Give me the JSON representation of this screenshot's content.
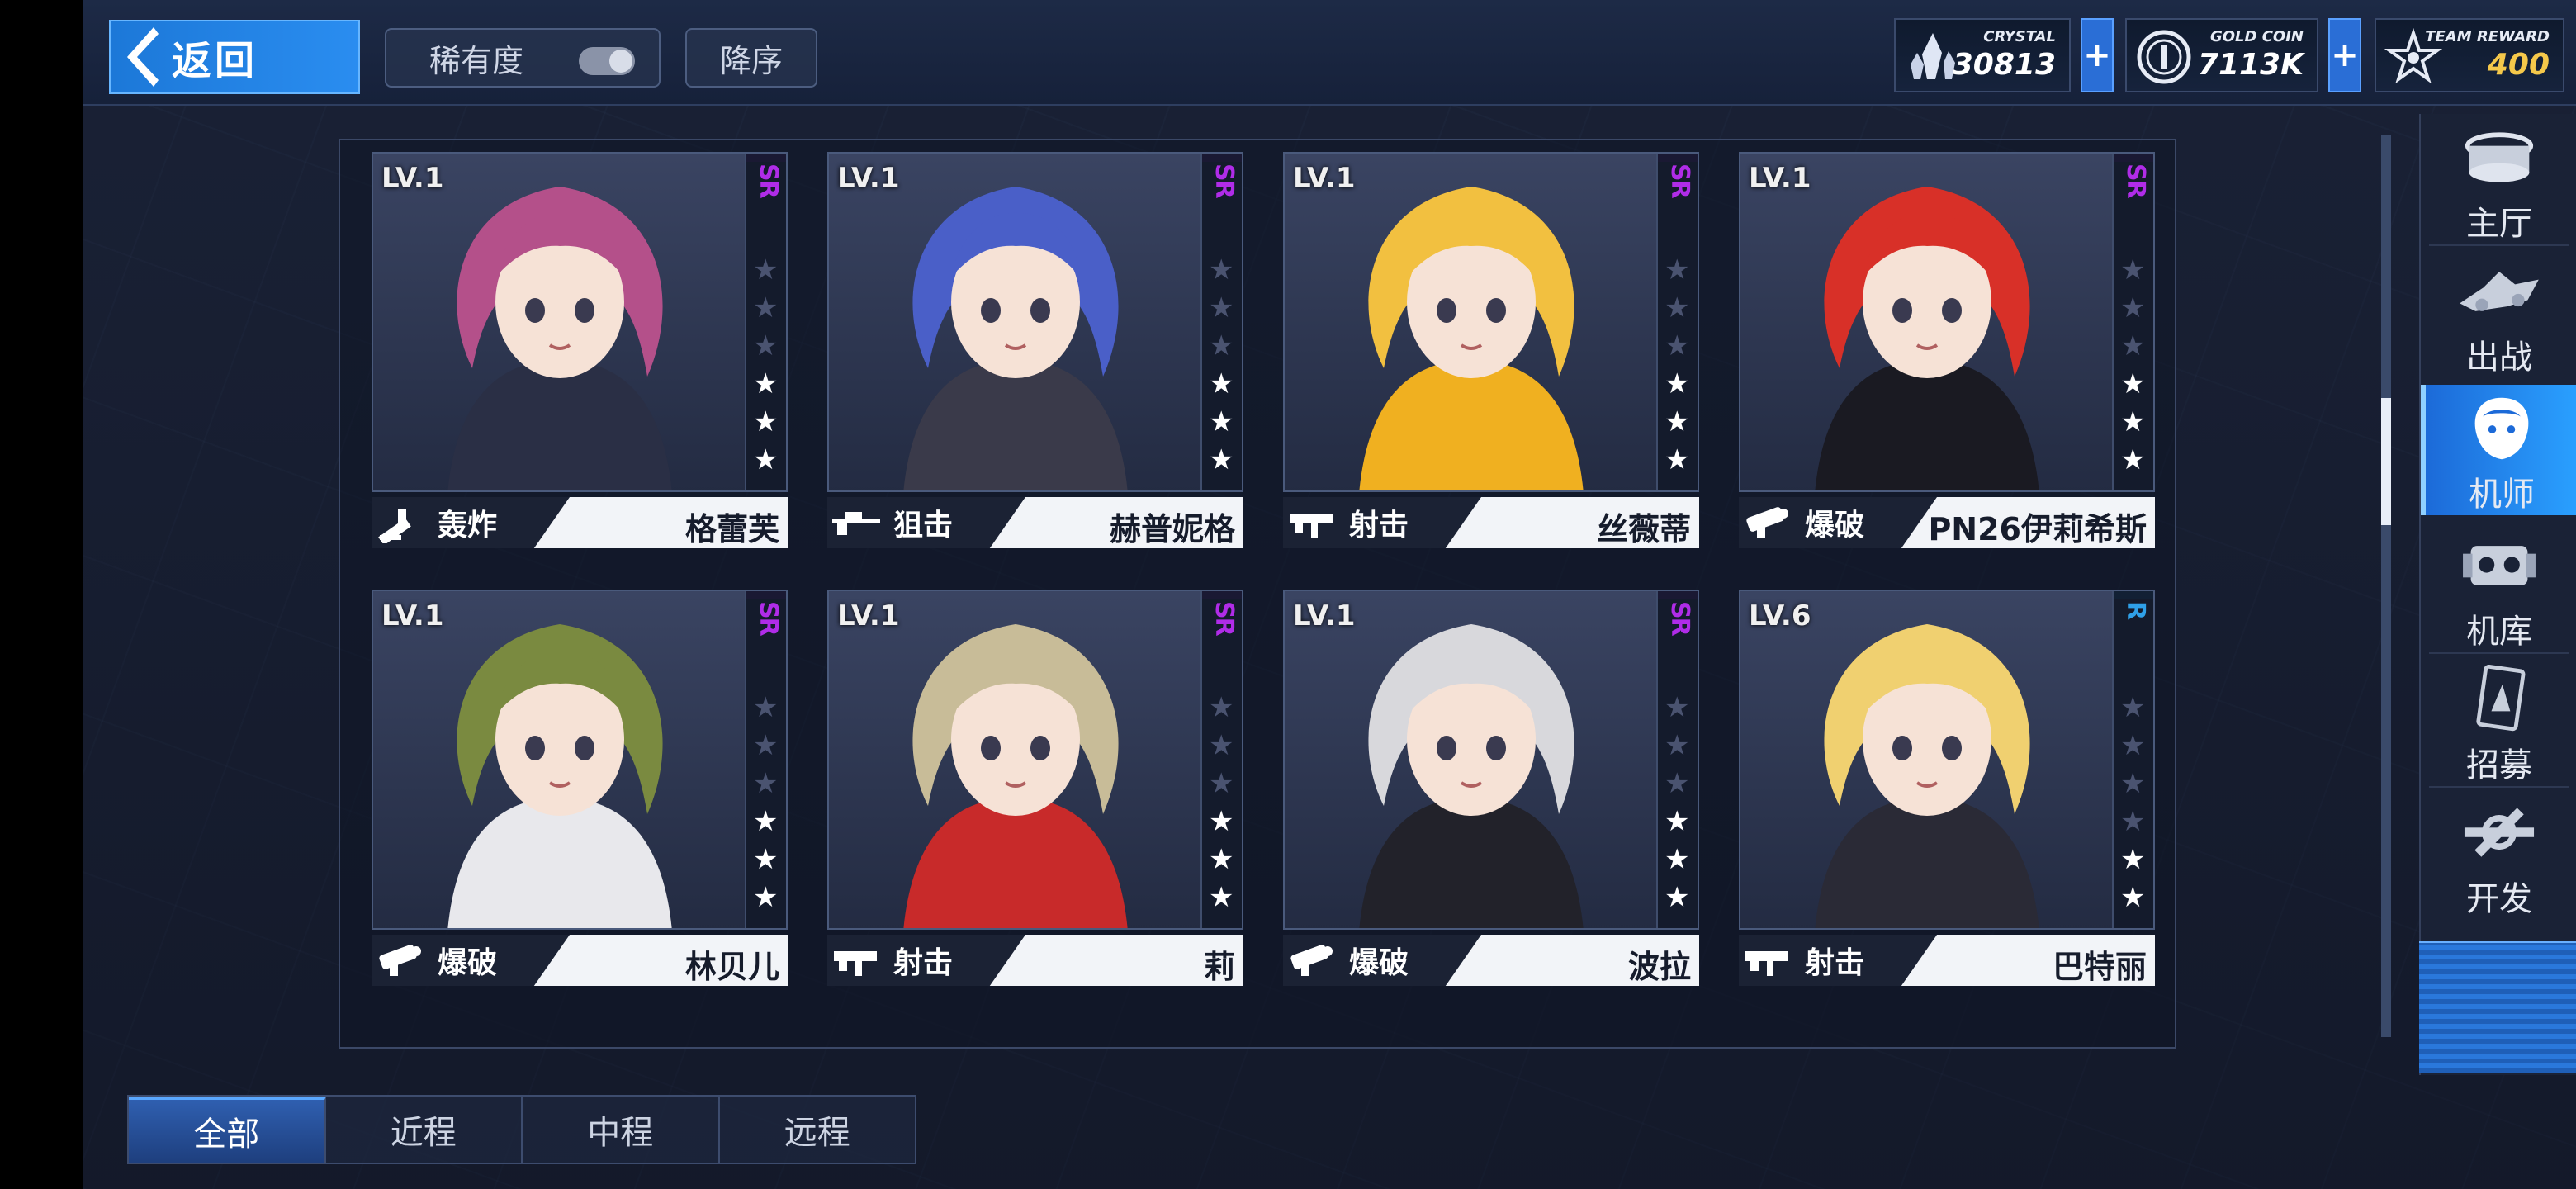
{
  "header": {
    "back_label": "返回",
    "rarity_label": "稀有度",
    "sort_label": "降序"
  },
  "resources": {
    "crystal": {
      "name": "CRYSTAL",
      "value": "30813",
      "icon": "crystal-icon"
    },
    "gold": {
      "name": "GOLD COIN",
      "value": "7113K",
      "icon": "gold-coin-icon"
    },
    "team": {
      "name": "TEAM REWARD",
      "value": "400",
      "icon": "team-star-icon"
    },
    "plus_label": "+"
  },
  "cards": [
    {
      "level": "LV.1",
      "rarity": "SR",
      "stars": 3,
      "role": "轰炸",
      "name": "格蕾芙",
      "hair": "#b4508a",
      "accent": "#2a2f45"
    },
    {
      "level": "LV.1",
      "rarity": "SR",
      "stars": 3,
      "role": "狙击",
      "name": "赫普妮格",
      "hair": "#4a5fc8",
      "accent": "#3a3a4a"
    },
    {
      "level": "LV.1",
      "rarity": "SR",
      "stars": 3,
      "role": "射击",
      "name": "丝薇蒂",
      "hair": "#f2c040",
      "accent": "#f0b020"
    },
    {
      "level": "LV.1",
      "rarity": "SR",
      "stars": 3,
      "role": "爆破",
      "name": "PN26伊莉希斯",
      "hair": "#d83028",
      "accent": "#1a1a22"
    },
    {
      "level": "LV.1",
      "rarity": "SR",
      "stars": 3,
      "role": "爆破",
      "name": "林贝儿",
      "hair": "#7a8a40",
      "accent": "#e8e8ec"
    },
    {
      "level": "LV.1",
      "rarity": "SR",
      "stars": 3,
      "role": "射击",
      "name": "莉",
      "hair": "#c8bc98",
      "accent": "#c82a2a"
    },
    {
      "level": "LV.1",
      "rarity": "SR",
      "stars": 3,
      "role": "爆破",
      "name": "波拉",
      "hair": "#d8d8dc",
      "accent": "#22222a"
    },
    {
      "level": "LV.6",
      "rarity": "R",
      "stars": 2,
      "role": "射击",
      "name": "巴特丽",
      "hair": "#f0d070",
      "accent": "#2a2a36"
    }
  ],
  "tabs": [
    "全部",
    "近程",
    "中程",
    "远程"
  ],
  "active_tab": "全部",
  "nav": [
    {
      "label": "主厅",
      "icon": "hall-icon"
    },
    {
      "label": "出战",
      "icon": "sortie-icon"
    },
    {
      "label": "机师",
      "icon": "pilot-icon"
    },
    {
      "label": "机库",
      "icon": "hangar-icon"
    },
    {
      "label": "招募",
      "icon": "recruit-icon"
    },
    {
      "label": "开发",
      "icon": "develop-icon"
    }
  ],
  "active_nav": "机师"
}
